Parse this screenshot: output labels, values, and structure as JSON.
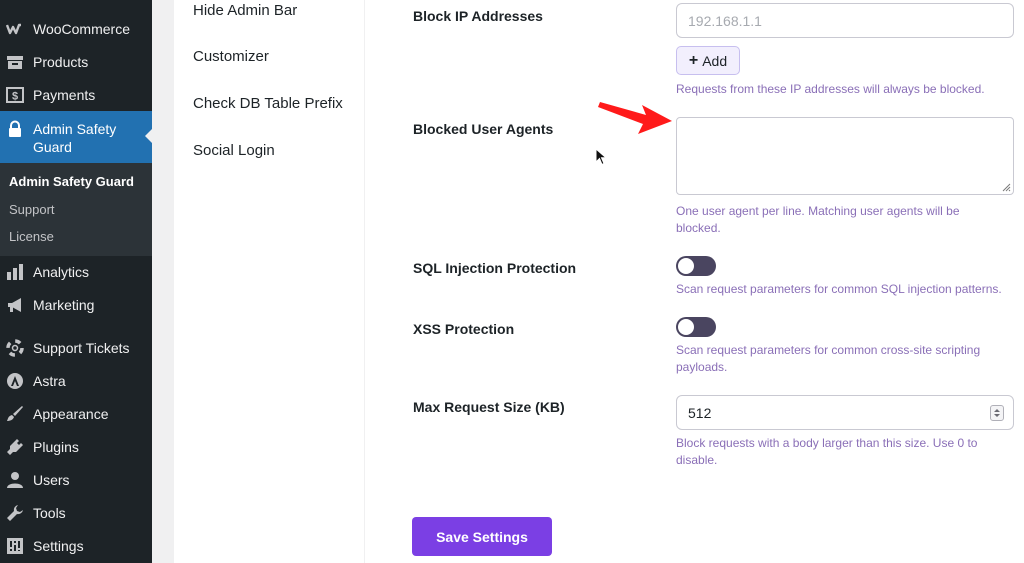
{
  "sidebar": {
    "items": [
      {
        "label": "WooCommerce",
        "icon": "woocommerce-icon"
      },
      {
        "label": "Products",
        "icon": "products-icon"
      },
      {
        "label": "Payments",
        "icon": "payments-icon"
      },
      {
        "label": "Admin Safety Guard",
        "icon": "lock-icon"
      },
      {
        "label": "Analytics",
        "icon": "analytics-icon"
      },
      {
        "label": "Marketing",
        "icon": "megaphone-icon"
      },
      {
        "label": "Support Tickets",
        "icon": "lifebuoy-icon"
      },
      {
        "label": "Astra",
        "icon": "astra-icon"
      },
      {
        "label": "Appearance",
        "icon": "paintbrush-icon"
      },
      {
        "label": "Plugins",
        "icon": "plugin-icon"
      },
      {
        "label": "Users",
        "icon": "user-icon"
      },
      {
        "label": "Tools",
        "icon": "wrench-icon"
      },
      {
        "label": "Settings",
        "icon": "settings-icon"
      }
    ],
    "submenu": [
      "Admin Safety Guard",
      "Support",
      "License"
    ]
  },
  "plugin_tabs": [
    "Hide Admin Bar",
    "Customizer",
    "Check DB Table Prefix",
    "Social Login"
  ],
  "form": {
    "block_ip": {
      "label": "Block IP Addresses",
      "placeholder": "192.168.1.1",
      "add_label": "Add",
      "help": "Requests from these IP addresses will always be blocked."
    },
    "user_agents": {
      "label": "Blocked User Agents",
      "help": "One user agent per line. Matching user agents will be blocked."
    },
    "sql_injection": {
      "label": "SQL Injection Protection",
      "enabled": false,
      "help": "Scan request parameters for common SQL injection patterns."
    },
    "xss": {
      "label": "XSS Protection",
      "enabled": false,
      "help": "Scan request parameters for common cross-site scripting payloads."
    },
    "max_request": {
      "label": "Max Request Size (KB)",
      "value": "512",
      "help": "Block requests with a body larger than this size. Use 0 to disable."
    },
    "save_label": "Save Settings"
  },
  "colors": {
    "sidebar_bg": "#1d2327",
    "sidebar_active": "#2271b1",
    "accent": "#7b3fe4",
    "help_text": "#8a6fb7",
    "annotation_arrow": "#ff1a1a"
  }
}
